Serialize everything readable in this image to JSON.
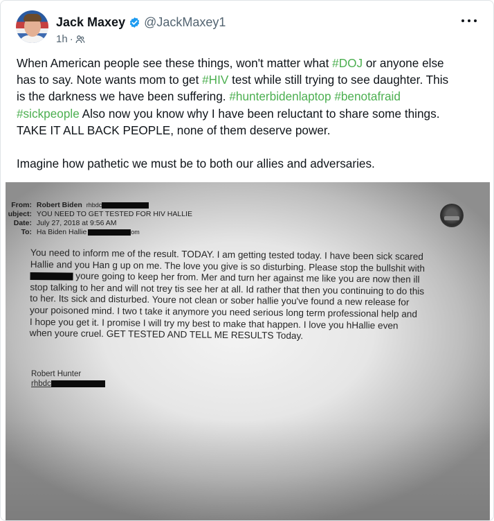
{
  "post": {
    "author": {
      "display_name": "Jack Maxey",
      "handle": "@JackMaxey1",
      "verified_icon": "verified-badge-icon",
      "avatar_icon": "avatar"
    },
    "timestamp": "1h",
    "separator": "·",
    "audience_icon": "globe-people-icon",
    "more_icon": "ellipsis-icon",
    "text": {
      "l1_a": "When American people see these things, won't matter what ",
      "l1_tag": "#DOJ",
      "l1_b": " or anyone else",
      "l2_a": "has to say. Note wants mom to get ",
      "l2_tag": "#HIV",
      "l2_b": " test while still trying to see daughter. This",
      "l3_a": "is the darkness we have been suffering. ",
      "l3_tag1": "#hunterbidenlaptop",
      "l3_tag2": "#benotafraid",
      "l4_tag": "#sickpeople",
      "l4_b": " Also now you know why I have been reluctant to share some things.",
      "l5": "TAKE IT ALL BACK PEOPLE, none of them deserve power.",
      "l6": "Imagine how pathetic we must be to both our allies and adversaries."
    },
    "hashtag_color": "#4caf50"
  },
  "photo": {
    "from_label": "From:",
    "from_value": "Robert Biden",
    "from_prefix": "rhbdc",
    "subject_label": "ubject:",
    "subject_value": "YOU NEED TO GET TESTED FOR HIV HALLIE",
    "date_label": "Date:",
    "date_value": "July 27, 2018 at 9:56 AM",
    "to_label": "To:",
    "to_value": "Ha Biden Hallie",
    "to_suffix": "om",
    "body_lines": [
      "You need to inform me of the result. TODAY. I am getting tested today. I have been sick scared",
      "Hallie and you Han g up on me. The love you give is so disturbing. Please stop the bullshit with",
      "youre going to keep her from. Mer and turn her against me like you are now then ill",
      "stop talking to her and will not trey tis see her at all. Id rather that then you continuing to do this",
      "to her. Its sick and disturbed. Youre  not clean or sober hallie you've found a new release for",
      "your  poisoned mind. I two t take it anymore you need serious long term professional help and",
      "I hope you get it. I promise I will try my best to make that happen.  I love you hHallie even",
      "when youre cruel. GET TESTED AND TELL ME RESULTS Today."
    ],
    "signature_name": "Robert Hunter",
    "signature_email_prefix": "rhbdc"
  }
}
